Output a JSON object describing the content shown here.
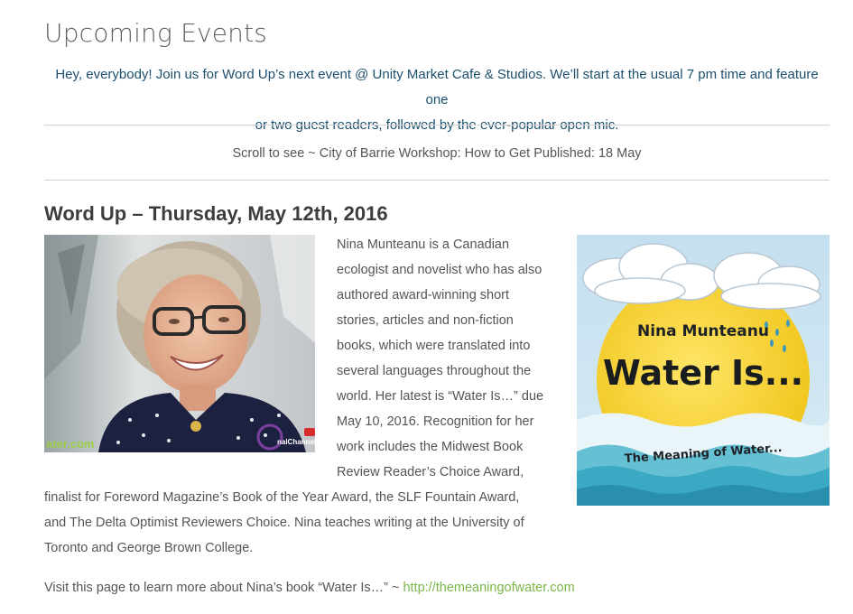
{
  "page": {
    "title": "Upcoming Events",
    "announcement": [
      "Hey, everybody! Join us for Word Up’s next event @ Unity Market Cafe & Studios. We’ll start at the usual 7 pm time and feature one",
      "or two guest readers, followed by the ever-popular open mic."
    ],
    "scroll_note": "Scroll to see ~ City of Barrie Workshop: How to Get Published: 18 May"
  },
  "event": {
    "title": "Word Up – Thursday, May 12th, 2016",
    "photo_watermark_left": "ater.com",
    "photo_watermark_right": "nalChannel",
    "bio_column_lines": [
      "Nina Munteanu is a Canadian",
      "ecologist and novelist who has also",
      "authored award-winning short",
      "stories, articles and non-fiction",
      "books, which were translated into",
      "several languages throughout the",
      "world. Her latest is “Water Is…” due",
      "May 10, 2016. Recognition for her",
      "work includes the Midwest Book",
      "Review Reader’s Choice Award,"
    ],
    "bio_full_lines": [
      "finalist for Foreword Magazine’s Book of the Year Award, the SLF Fountain Award,",
      "and The Delta Optimist Reviewers Choice. Nina teaches writing at the University of",
      "Toronto and George Brown College."
    ],
    "visit_text": "Visit this page to learn more about Nina’s book “Water Is…” ~ ",
    "visit_link": "http://themeaningofwater.com"
  },
  "book_cover": {
    "author": "Nina Munteanu",
    "title": "Water Is...",
    "subtitle": "The Meaning of Water..."
  },
  "colors": {
    "announcement": "#1d4f6e",
    "link": "#7ab648",
    "sun": "#f5d21b",
    "water": "#3aa6c4"
  }
}
